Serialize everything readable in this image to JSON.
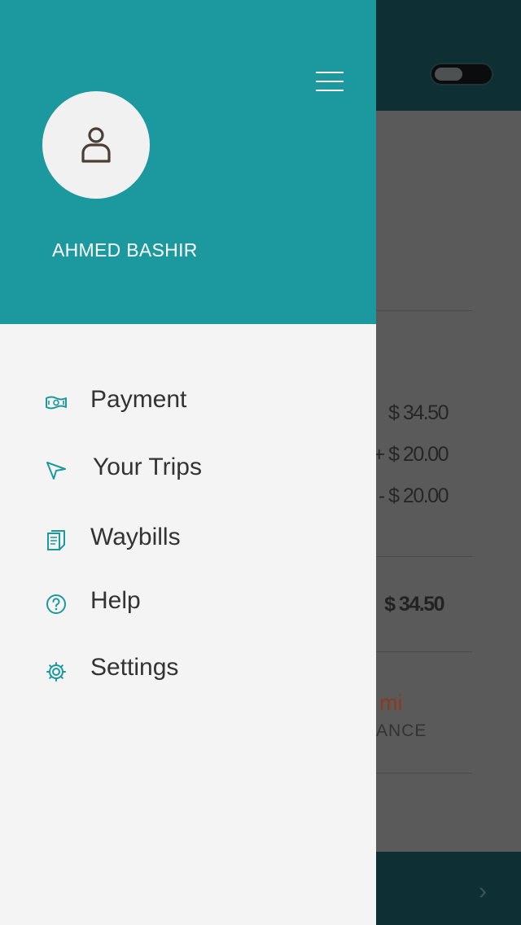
{
  "drawer": {
    "user_name": "AHMED BASHIR",
    "menu": [
      {
        "label": "Payment",
        "icon": "cash-icon"
      },
      {
        "label": "Your Trips",
        "icon": "navigation-arrow-icon"
      },
      {
        "label": "Waybills",
        "icon": "document-icon"
      },
      {
        "label": "Help",
        "icon": "help-circle-icon"
      },
      {
        "label": "Settings",
        "icon": "gear-icon"
      }
    ]
  },
  "background": {
    "amounts": [
      "$ 34.50",
      "+ $ 20.00",
      "- $ 20.00"
    ],
    "total": "$ 34.50",
    "distance_value": "mi",
    "distance_label": "ANCE"
  },
  "colors": {
    "accent": "#1b999f",
    "header_dark": "#0e2f33",
    "drawer_bg": "#f4f4f4"
  }
}
